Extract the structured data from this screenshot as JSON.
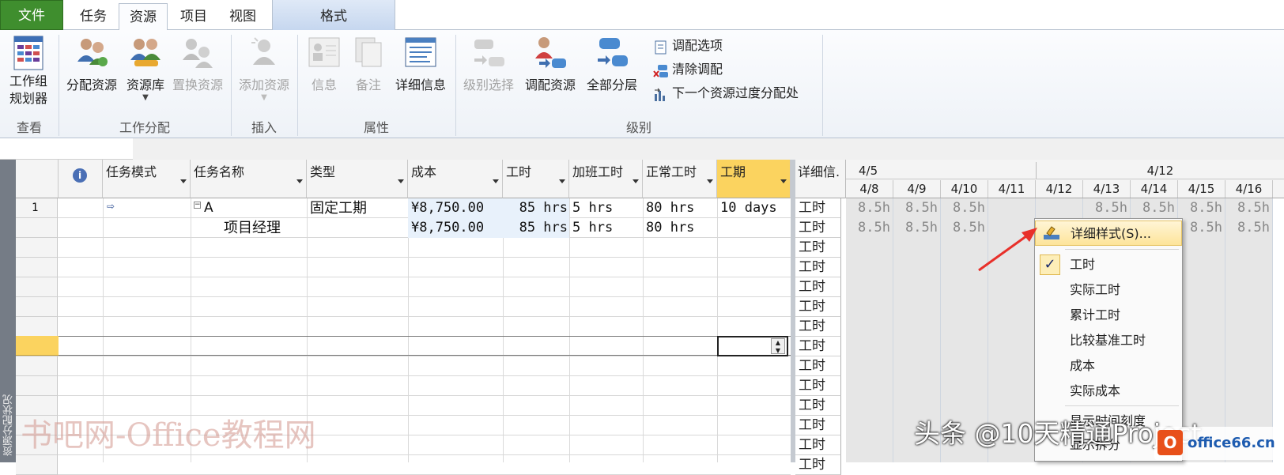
{
  "tabs": {
    "file": "文件",
    "task": "任务",
    "resource": "资源",
    "project": "项目",
    "view": "视图",
    "format": "格式"
  },
  "ribbon": {
    "team_planner": [
      "工作组",
      "规划器"
    ],
    "assign_resources": "分配资源",
    "resource_pool": "资源库",
    "replace_resource": "置换资源",
    "add_resource": "添加资源",
    "information": "信息",
    "notes": "备注",
    "details": "详细信息",
    "level_selection": "级别选择",
    "level_resource": "调配资源",
    "level_all": "全部分层",
    "leveling_options": "调配选项",
    "clear_leveling": "清除调配",
    "next_overallocation": "下一个资源过度分配处",
    "groups": {
      "view": "查看",
      "assignments": "工作分配",
      "insert": "插入",
      "properties": "属性",
      "level": "级别"
    }
  },
  "table": {
    "headers": {
      "mode": "任务模式",
      "name": "任务名称",
      "type": "类型",
      "cost": "成本",
      "work": "工时",
      "overtime": "加班工时",
      "regular": "正常工时",
      "duration": "工期",
      "details": "详细信."
    },
    "rows": [
      {
        "id": "1",
        "name": "A",
        "type": "固定工期",
        "cost": "¥8,750.00",
        "work": "85 hrs",
        "overtime": "5 hrs",
        "regular": "80 hrs",
        "duration": "10 days"
      },
      {
        "id": "",
        "name": "项目经理",
        "type": "",
        "cost": "¥8,750.00",
        "work": "85 hrs",
        "overtime": "5 hrs",
        "regular": "80 hrs",
        "duration": ""
      }
    ],
    "side_label": "资源分配状况"
  },
  "timescale": {
    "weeks": [
      "4/5",
      "4/12"
    ],
    "days": [
      "4/8",
      "4/9",
      "4/10",
      "4/11",
      "4/12",
      "4/13",
      "4/14",
      "4/15",
      "4/16"
    ],
    "detail_label": "工时",
    "row1": [
      "8.5h",
      "8.5h",
      "8.5h",
      "",
      "",
      "8.5h",
      "8.5h",
      "8.5h",
      "8.5h"
    ],
    "row2": [
      "8.5h",
      "8.5h",
      "8.5h",
      "",
      "",
      "",
      "",
      "8.5h",
      "8.5h"
    ]
  },
  "context_menu": {
    "items": [
      "详细样式(S)...",
      "工时",
      "实际工时",
      "累计工时",
      "比较基准工时",
      "成本",
      "实际成本",
      "显示时间刻度",
      "显示拆分"
    ]
  },
  "watermarks": {
    "left": "书吧网-Office教程网",
    "right": "头条 @10天精通Project",
    "logo": "office66.cn"
  },
  "colors": {
    "file_tab": "#3f8e2e",
    "selected_header": "#fbd35f",
    "menu_highlight": "#fde49a",
    "arrow": "#e8302a"
  }
}
